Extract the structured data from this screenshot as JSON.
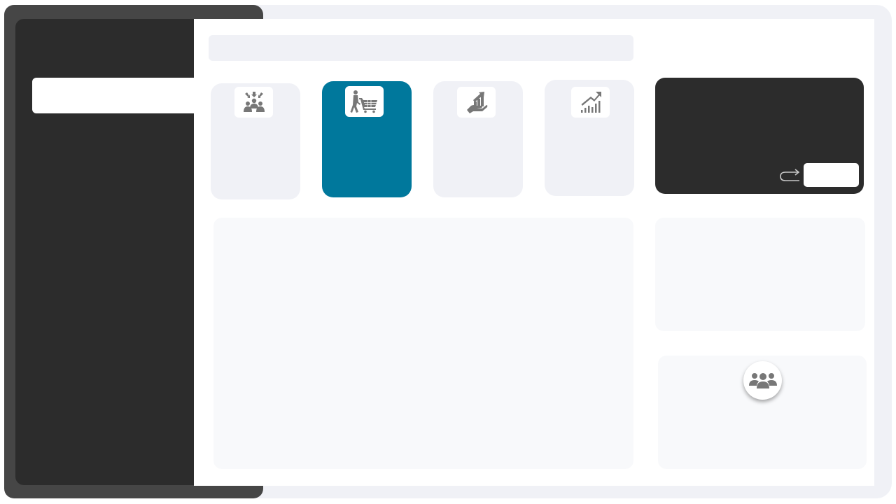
{
  "colors": {
    "frame": "#f0f1f6",
    "frame_dark": "#464646",
    "sidebar": "#2c2c2c",
    "accent": "#00789c",
    "tile": "#f0f1f6",
    "icon": "#777777"
  },
  "sidebar": {
    "active_item": ""
  },
  "search": {
    "placeholder": ""
  },
  "tiles": [
    {
      "icon": "community-meeting-icon",
      "label": "",
      "active": false
    },
    {
      "icon": "shopping-cart-icon",
      "label": "",
      "active": true
    },
    {
      "icon": "investment-growth-icon",
      "label": "",
      "active": false
    },
    {
      "icon": "analytics-chart-icon",
      "label": "",
      "active": false
    }
  ],
  "promo": {
    "icon": "share-arrow-icon",
    "button_label": ""
  },
  "team": {
    "icon": "users-group-icon"
  }
}
